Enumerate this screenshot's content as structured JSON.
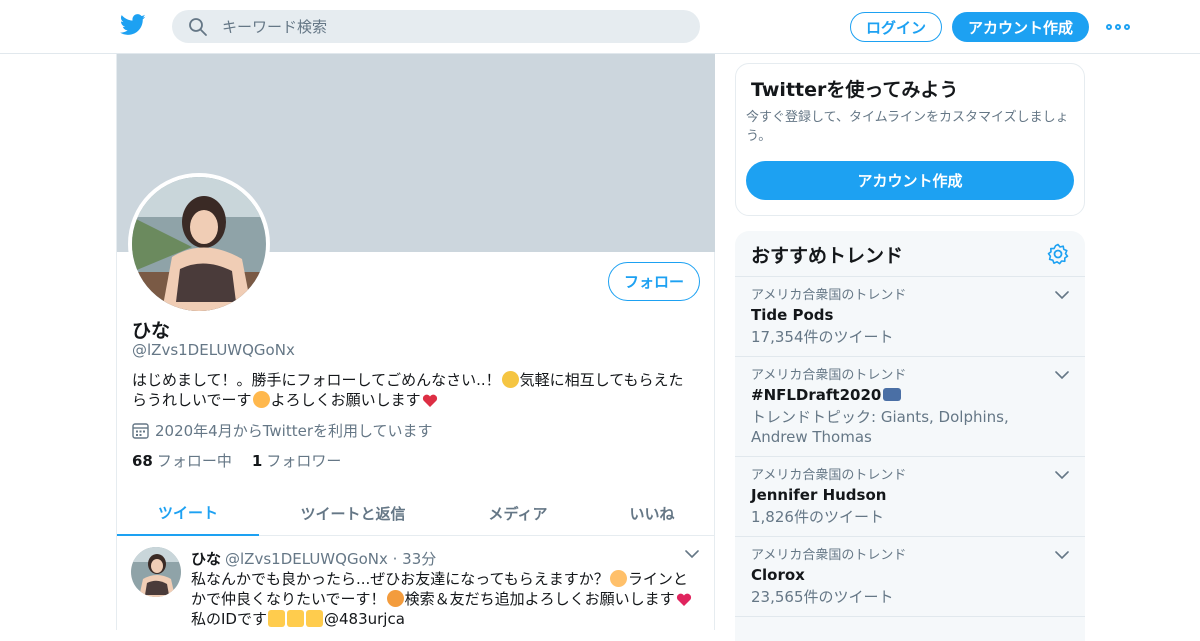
{
  "header": {
    "search_placeholder": "キーワード検索",
    "login_label": "ログイン",
    "signup_label": "アカウント作成"
  },
  "profile": {
    "name": "ひな",
    "handle": "@lZvs1DELUWQGoNx",
    "follow_label": "フォロー",
    "bio_1": "はじめまして！。勝手にフォローしてごめんなさい..！",
    "bio_2": "気軽に相互してもらえたらうれしいでーす",
    "bio_3": "よろしくお願いします",
    "joined": "2020年4月からTwitterを利用しています",
    "following_count": "68",
    "following_label": "フォロー中",
    "followers_count": "1",
    "followers_label": "フォロワー"
  },
  "tabs": [
    {
      "label": "ツイート"
    },
    {
      "label": "ツイートと返信"
    },
    {
      "label": "メディア"
    },
    {
      "label": "いいね"
    }
  ],
  "tweet": {
    "name": "ひな",
    "handle": "@lZvs1DELUWQGoNx",
    "time": "· 33分",
    "text_1": "私なんかでも良かったら...ぜひお友達になってもらえますか？",
    "text_2": "ラインとかで仲良くなりたいでーす！",
    "text_3": "検索＆友だち追加よろしくお願いします",
    "text_4": "私のIDです",
    "text_5": "@483urjca"
  },
  "signup_card": {
    "title": "Twitterを使ってみよう",
    "desc": "今すぐ登録して、タイムラインをカスタマイズしましょう。",
    "button": "アカウント作成"
  },
  "trends": {
    "title": "おすすめトレンド",
    "items": [
      {
        "context": "アメリカ合衆国のトレンド",
        "name": "Tide Pods",
        "meta": "17,354件のツイート"
      },
      {
        "context": "アメリカ合衆国のトレンド",
        "name": "#NFLDraft2020",
        "meta": "トレンドトピック: Giants, Dolphins, Andrew Thomas"
      },
      {
        "context": "アメリカ合衆国のトレンド",
        "name": "Jennifer Hudson",
        "meta": "1,826件のツイート"
      },
      {
        "context": "アメリカ合衆国のトレンド",
        "name": "Clorox",
        "meta": "23,565件のツイート"
      }
    ]
  },
  "colors": {
    "accent": "#1da1f2",
    "banner": "#ccd6dd",
    "muted_text": "#657786"
  },
  "icons": [
    "twitter-bird-icon",
    "search-icon",
    "more-icon",
    "calendar-icon",
    "chevron-down-icon",
    "gear-icon"
  ]
}
